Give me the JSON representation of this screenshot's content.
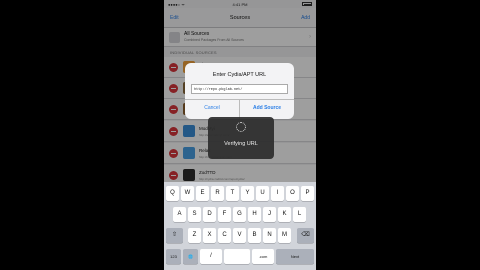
{
  "status": {
    "time": "4:41 PM"
  },
  "nav": {
    "edit": "Edit",
    "title": "Sources",
    "add": "Add"
  },
  "all_sources": {
    "title": "All Sources",
    "subtitle": "Combined Packages From All Sources"
  },
  "section_header": "INDIVIDUAL SOURCES",
  "sources": [
    {
      "name": "BigBoss",
      "url": "http://apt.thebigboss.org/repofiles/cydia/",
      "icon_color": "#f2a23c"
    },
    {
      "name": "Cydia/Telesphoreo",
      "url": "http://apt.saurik.com/",
      "icon_color": "#8a6a3c"
    },
    {
      "name": "ModMyi",
      "url": "http://apt.modmyi.com/",
      "icon_color": "#3b8fd9"
    },
    {
      "name": "Relax",
      "url": "http://repo.example.com/",
      "icon_color": "#4aa0e6"
    },
    {
      "name": "ZodTTD",
      "url": "http://cydia.zodttd.com/repo/cydia/",
      "icon_color": "#2b2b2b"
    }
  ],
  "alert": {
    "title": "Enter Cydia/APT URL",
    "field_value": "http://repo.pkglab.net/",
    "cancel": "Cancel",
    "add_source": "Add Source"
  },
  "hud": {
    "text": "Verifying URL"
  },
  "keyboard": {
    "row1": [
      "Q",
      "W",
      "E",
      "R",
      "T",
      "Y",
      "U",
      "I",
      "O",
      "P"
    ],
    "row2": [
      "A",
      "S",
      "D",
      "F",
      "G",
      "H",
      "J",
      "K",
      "L"
    ],
    "row3": [
      "Z",
      "X",
      "C",
      "V",
      "B",
      "N",
      "M"
    ],
    "shift": "⇧",
    "delete": "⌫",
    "numbers": "123",
    "globe": "🌐",
    "slash": "/",
    "dotcom": ".com",
    "next": "Next"
  }
}
